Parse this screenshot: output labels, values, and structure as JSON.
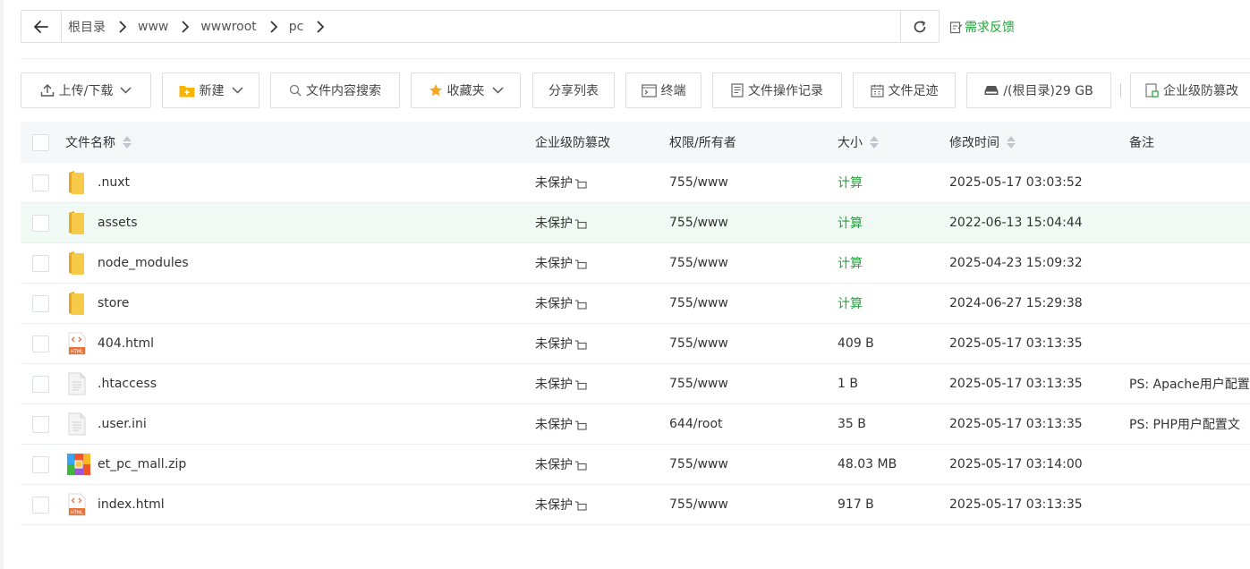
{
  "pathbar": {
    "crumbs": [
      "根目录",
      "www",
      "wwwroot",
      "pc"
    ]
  },
  "feedback_label": "需求反馈",
  "toolbar": {
    "upload_download": "上传/下载",
    "new": "新建",
    "content_search": "文件内容搜索",
    "favorites": "收藏夹",
    "share_list": "分享列表",
    "terminal": "终端",
    "operation_log": "文件操作记录",
    "file_footprint": "文件足迹",
    "disk": "/(根目录)29 GB",
    "tamper_proof": "企业级防篡改"
  },
  "table": {
    "headers": {
      "name": "文件名称",
      "tamper": "企业级防篡改",
      "perm": "权限/所有者",
      "size": "大小",
      "mtime": "修改时间",
      "note": "备注"
    },
    "rows": [
      {
        "icon": "folder-icon",
        "name": ".nuxt",
        "tamper": "未保护",
        "perm": "755/www",
        "size": "计算",
        "size_is_link": true,
        "mtime": "2025-05-17 03:03:52",
        "note": ""
      },
      {
        "icon": "folder-icon",
        "name": "assets",
        "tamper": "未保护",
        "perm": "755/www",
        "size": "计算",
        "size_is_link": true,
        "mtime": "2022-06-13 15:04:44",
        "note": "",
        "highlighted": true
      },
      {
        "icon": "folder-icon",
        "name": "node_modules",
        "tamper": "未保护",
        "perm": "755/www",
        "size": "计算",
        "size_is_link": true,
        "mtime": "2025-04-23 15:09:32",
        "note": ""
      },
      {
        "icon": "folder-icon",
        "name": "store",
        "tamper": "未保护",
        "perm": "755/www",
        "size": "计算",
        "size_is_link": true,
        "mtime": "2024-06-27 15:29:38",
        "note": ""
      },
      {
        "icon": "html-file-icon",
        "name": "404.html",
        "tamper": "未保护",
        "perm": "755/www",
        "size": "409 B",
        "mtime": "2025-05-17 03:13:35",
        "note": ""
      },
      {
        "icon": "text-file-icon",
        "name": ".htaccess",
        "tamper": "未保护",
        "perm": "755/www",
        "size": "1 B",
        "mtime": "2025-05-17 03:13:35",
        "note": "PS: Apache用户配置"
      },
      {
        "icon": "text-file-icon",
        "name": ".user.ini",
        "tamper": "未保护",
        "perm": "644/root",
        "size": "35 B",
        "mtime": "2025-05-17 03:13:35",
        "note": "PS: PHP用户配置文"
      },
      {
        "icon": "zip-file-icon",
        "name": "et_pc_mall.zip",
        "tamper": "未保护",
        "perm": "755/www",
        "size": "48.03 MB",
        "mtime": "2025-05-17 03:14:00",
        "note": ""
      },
      {
        "icon": "html-file-icon",
        "name": "index.html",
        "tamper": "未保护",
        "perm": "755/www",
        "size": "917 B",
        "mtime": "2025-05-17 03:13:35",
        "note": ""
      }
    ]
  },
  "colors": {
    "accent_green": "#20a53a",
    "folder_yellow": "#f7c948",
    "html_orange": "#e8743b"
  }
}
